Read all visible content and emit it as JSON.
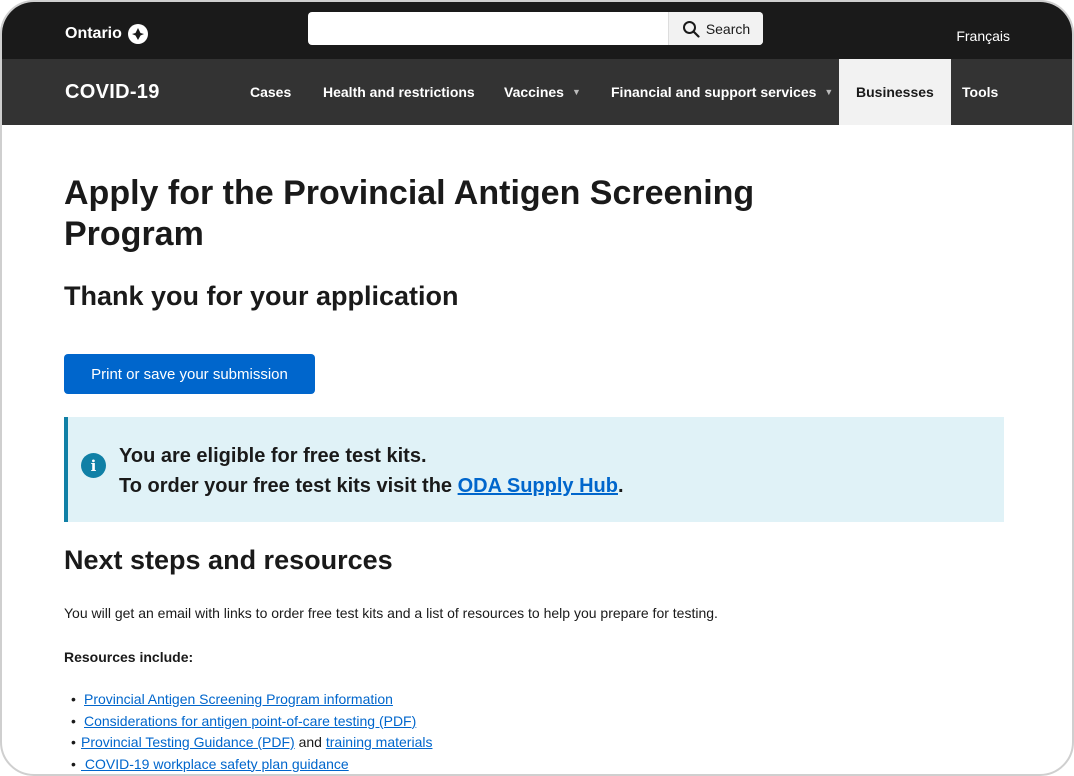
{
  "header": {
    "logo_text": "Ontario",
    "search": {
      "value": "",
      "placeholder": "",
      "button_label": "Search"
    },
    "language_toggle": "Français"
  },
  "nav": {
    "brand": "COVID-19",
    "items": [
      {
        "label": "Cases",
        "has_dropdown": false,
        "active": false
      },
      {
        "label": "Health and restrictions",
        "has_dropdown": false,
        "active": false
      },
      {
        "label": "Vaccines",
        "has_dropdown": true,
        "active": false
      },
      {
        "label": "Financial and support services",
        "has_dropdown": true,
        "active": false
      },
      {
        "label": "Businesses",
        "has_dropdown": false,
        "active": true
      },
      {
        "label": "Tools",
        "has_dropdown": false,
        "active": false
      }
    ]
  },
  "main": {
    "title": "Apply for the Provincial Antigen Screening Program",
    "subtitle": "Thank you for your application",
    "print_button": "Print or save your submission",
    "alert": {
      "line1": "You are eligible for free test kits.",
      "line2_prefix": "To order your free test kits visit the ",
      "line2_link": "ODA Supply Hub",
      "line2_suffix": "."
    },
    "next_steps_heading": "Next steps and resources",
    "email_text": "You will get an email with links to order free test kits and a list of resources to help you prepare for testing.",
    "resources_label": "Resources include:",
    "resources": [
      {
        "link": "Provincial Antigen Screening Program information"
      },
      {
        "link": "Considerations for antigen point-of-care testing (PDF)"
      },
      {
        "link": "Provincial Testing Guidance (PDF)",
        "connector": " and ",
        "link2": "training materials"
      },
      {
        "link": " COVID-19 workplace safety plan guidance"
      }
    ]
  },
  "colors": {
    "topbar": "#1a1a1a",
    "navbar": "#333333",
    "primary_button": "#0066cc",
    "alert_background": "#e0f2f7",
    "alert_accent": "#1080a6",
    "link": "#0066cc"
  }
}
